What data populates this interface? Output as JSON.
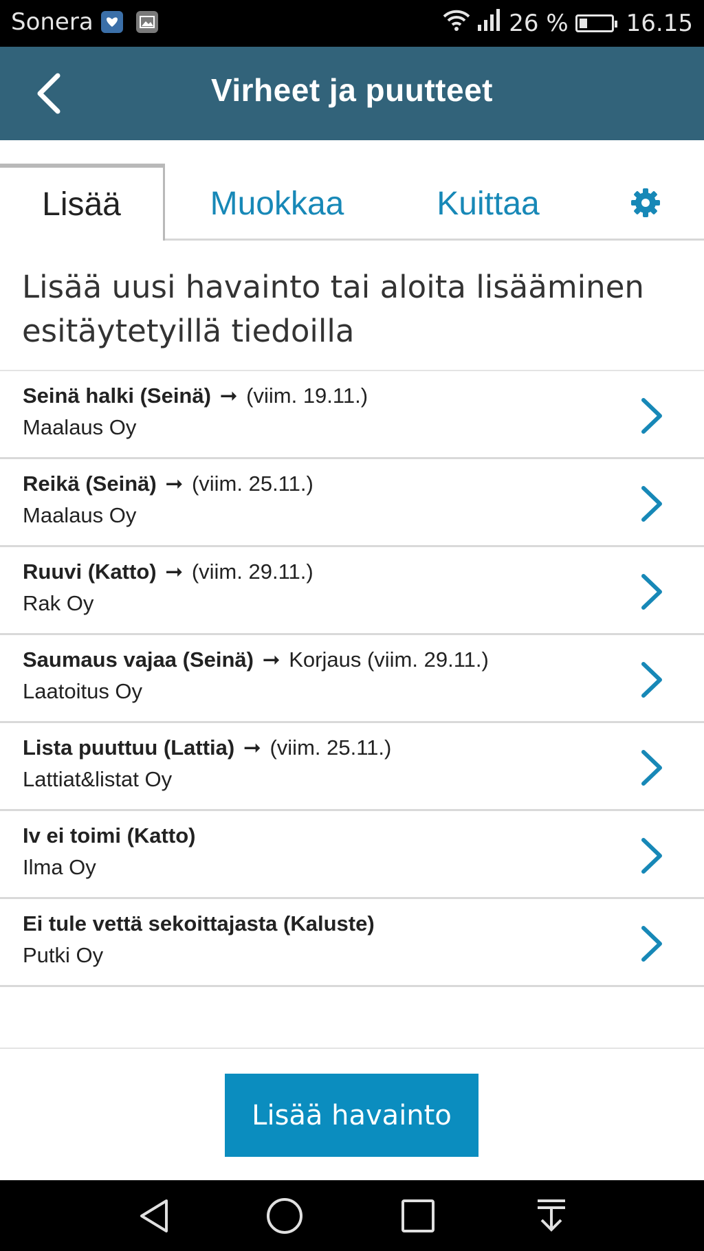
{
  "status_bar": {
    "carrier": "Sonera",
    "notification_icons": [
      "health-app-icon",
      "gallery-icon"
    ],
    "battery": "26 %",
    "battery_level": 0.26,
    "time": "16.15",
    "icons": [
      "wifi-icon",
      "signal-icon",
      "battery-icon"
    ]
  },
  "header": {
    "title": "Virheet ja puutteet",
    "color": "#32637a"
  },
  "tabs": [
    {
      "label": "Lisää",
      "active": true
    },
    {
      "label": "Muokkaa",
      "active": false
    },
    {
      "label": "Kuittaa",
      "active": false
    },
    {
      "icon": "gear-icon",
      "active": false
    }
  ],
  "intro": "Lisää uusi havainto tai aloita lisääminen esitäytetyillä tiedoilla",
  "items": [
    {
      "title": "Seinä halki (Seinä)",
      "arrow": "➞",
      "detail": "(viim. 19.11.)",
      "company": "Maalaus Oy"
    },
    {
      "title": "Reikä (Seinä)",
      "arrow": "➞",
      "detail": "(viim. 25.11.)",
      "company": "Maalaus Oy"
    },
    {
      "title": "Ruuvi (Katto)",
      "arrow": "➞",
      "detail": "(viim. 29.11.)",
      "company": "Rak Oy"
    },
    {
      "title": "Saumaus vajaa (Seinä)",
      "arrow": "➞",
      "detail": "Korjaus (viim. 29.11.)",
      "company": "Laatoitus Oy"
    },
    {
      "title": "Lista puuttuu (Lattia)",
      "arrow": "➞",
      "detail": "(viim. 25.11.)",
      "company": "Lattiat&listat Oy"
    },
    {
      "title": "Iv ei toimi (Katto)",
      "arrow": "",
      "detail": "",
      "company": "Ilma Oy"
    },
    {
      "title": "Ei tule vettä sekoittajasta (Kaluste)",
      "arrow": "",
      "detail": "",
      "company": "Putki Oy"
    }
  ],
  "add_button": {
    "label": "Lisää havainto",
    "color": "#0b8dbf"
  },
  "nav_bar": [
    "back-triangle-icon",
    "home-circle-icon",
    "recents-square-icon",
    "notification-pull-icon"
  ],
  "accent_color": "#1788b7"
}
